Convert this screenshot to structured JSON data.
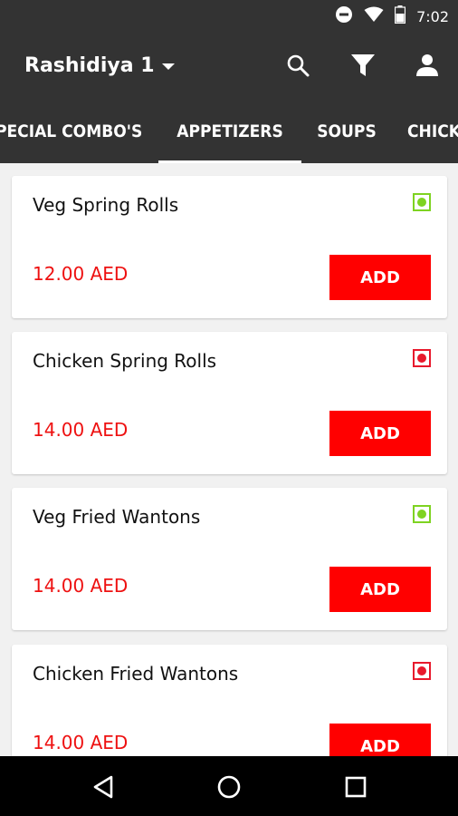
{
  "status_bar": {
    "time": "7:02",
    "icons": [
      "do-not-disturb-icon",
      "wifi-icon",
      "battery-icon"
    ]
  },
  "header": {
    "location": "Rashidiya 1",
    "actions": [
      "search-icon",
      "filter-icon",
      "account-icon"
    ]
  },
  "tabs": [
    {
      "label": "SPECIAL COMBO'S"
    },
    {
      "label": "APPETIZERS",
      "active": true
    },
    {
      "label": "SOUPS"
    },
    {
      "label": "CHICKEN"
    }
  ],
  "items": [
    {
      "name": "Veg Spring Rolls",
      "price": "12.00 AED",
      "veg": true,
      "button": "ADD"
    },
    {
      "name": "Chicken Spring Rolls",
      "price": "14.00 AED",
      "veg": false,
      "button": "ADD"
    },
    {
      "name": "Veg Fried Wantons",
      "price": "14.00 AED",
      "veg": true,
      "button": "ADD"
    },
    {
      "name": "Chicken Fried Wantons",
      "price": "14.00 AED",
      "veg": false,
      "button": "ADD"
    }
  ],
  "colors": {
    "app_bar": "#333333",
    "accent": "#ff0000",
    "price": "#ee1111",
    "veg": "#7ed321",
    "non_veg": "#e8192c"
  },
  "nav_bar": {
    "buttons": [
      "back-icon",
      "home-icon",
      "recents-icon"
    ]
  }
}
